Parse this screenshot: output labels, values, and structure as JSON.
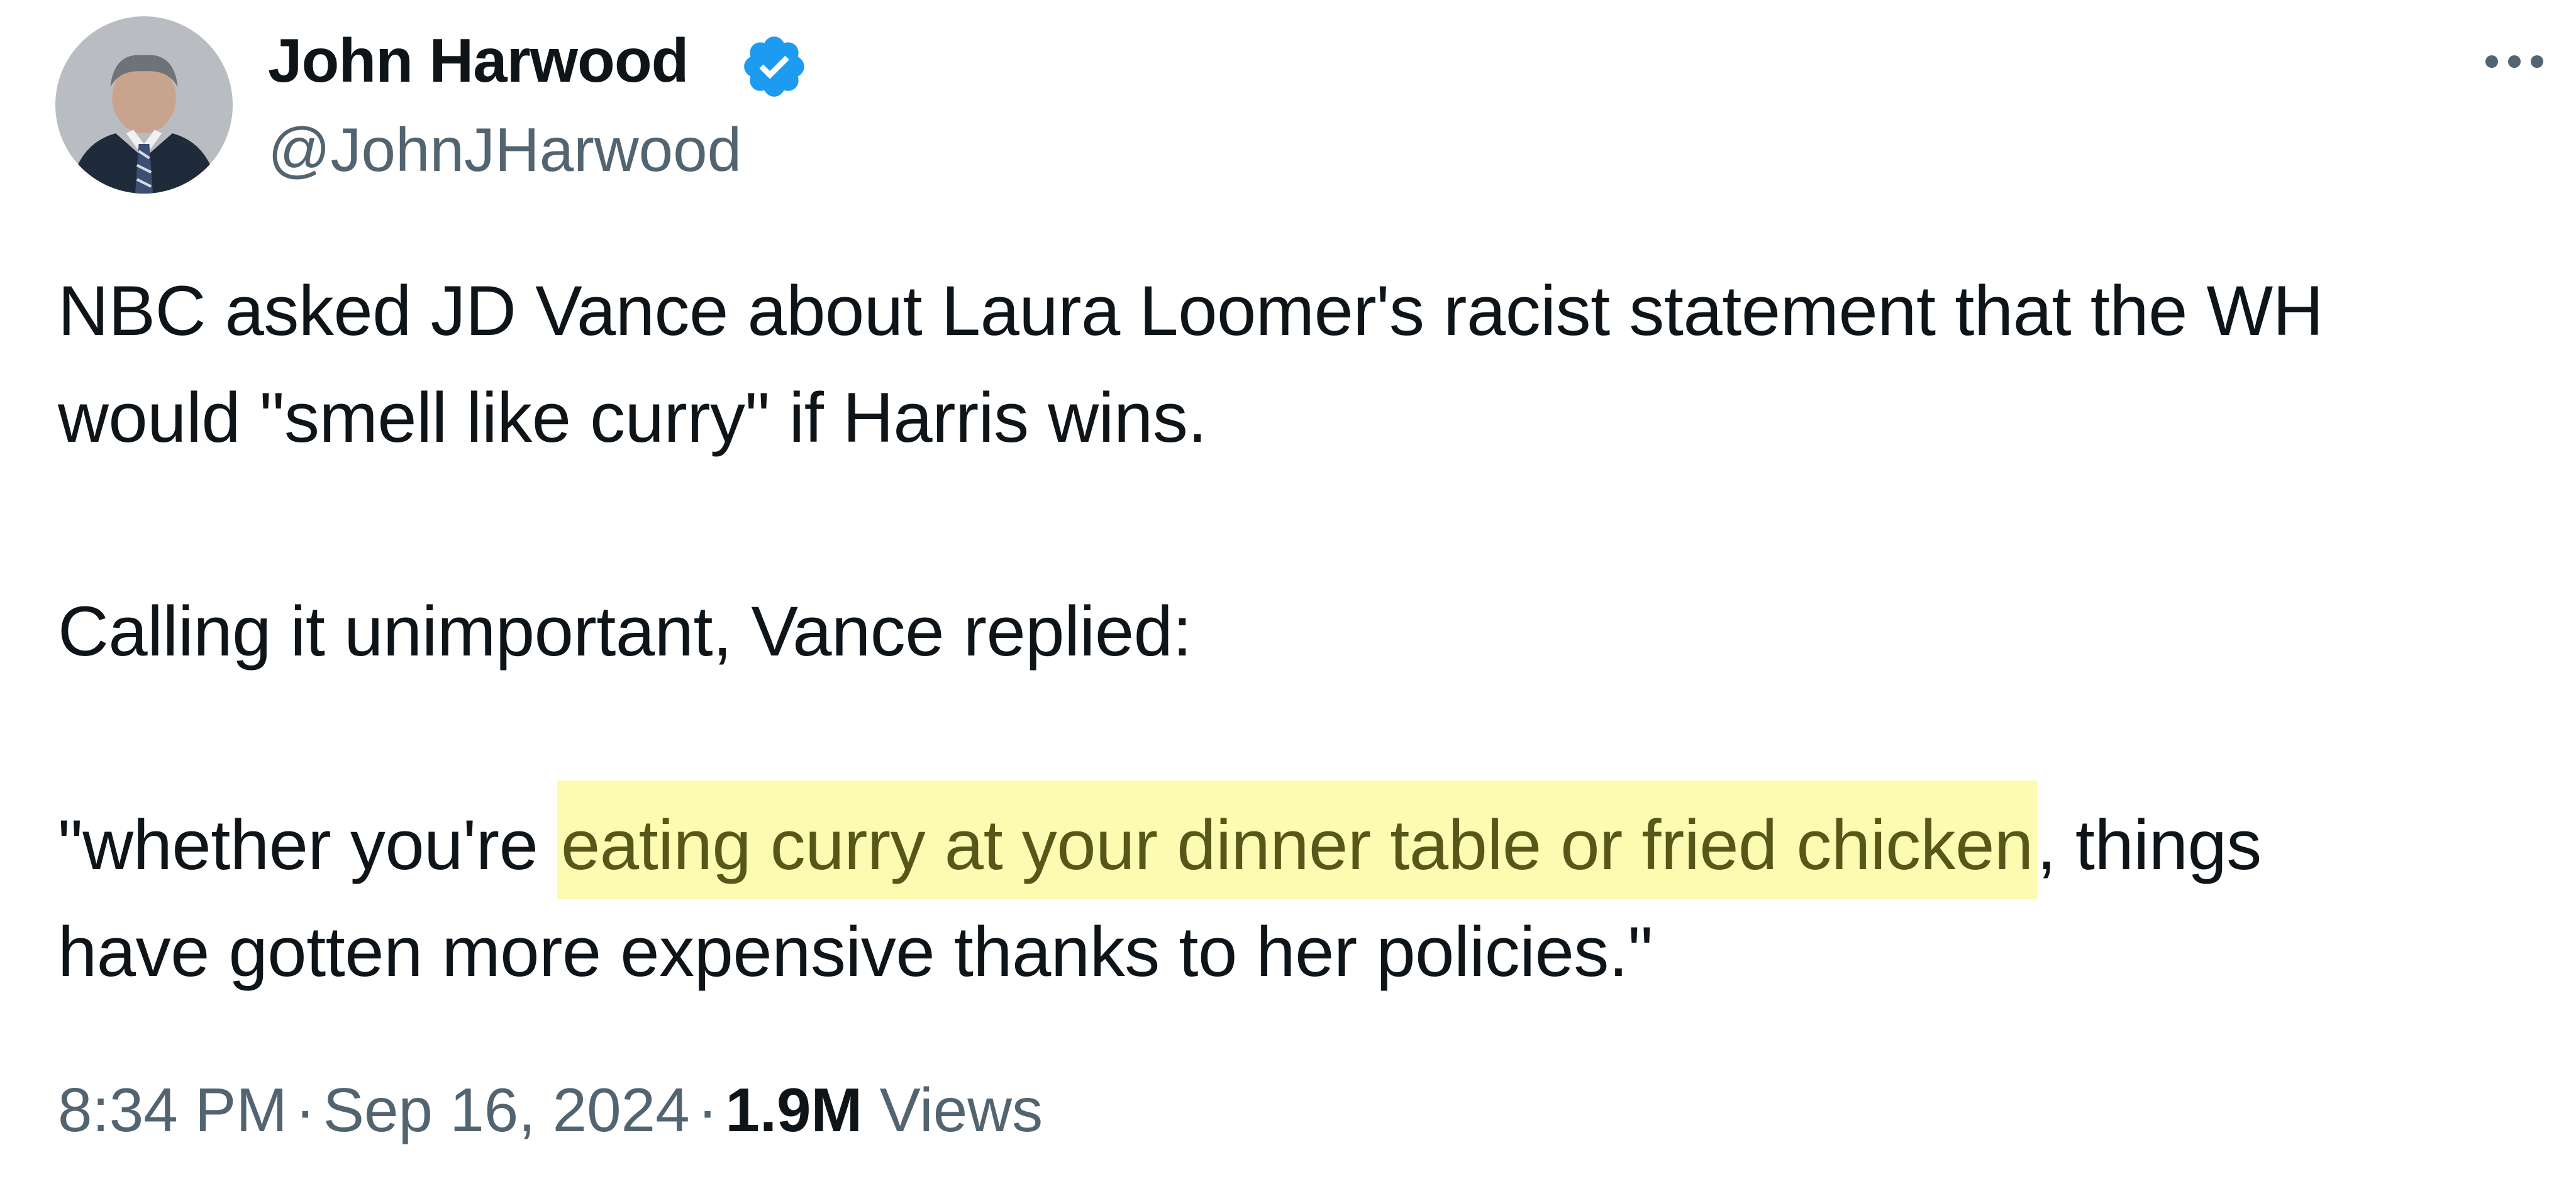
{
  "author": {
    "display_name": "John Harwood",
    "handle": "@JohnJHarwood",
    "verified": true,
    "avatar_icon": "avatar-photo"
  },
  "icons": {
    "verified": "verified-badge-icon",
    "more": "more-options-icon"
  },
  "tweet": {
    "line1": "NBC asked JD Vance about Laura Loomer's racist statement that the WH",
    "line2": "would \"smell like curry\" if Harris wins.",
    "line3": "Calling it unimportant, Vance replied:",
    "line4_before": "\"whether you're ",
    "line4_highlight": "eating curry at your dinner table or fried chicken",
    "line4_after": ", things",
    "line5": "have gotten more expensive thanks to her policies.\""
  },
  "meta": {
    "time": "8:34 PM",
    "separator": "·",
    "date": "Sep 16, 2024",
    "views_count": "1.9M",
    "views_label": "Views"
  },
  "colors": {
    "text": "#0f1419",
    "secondary": "#536471",
    "verified_blue": "#1d9bf0",
    "highlight_bg": "#fdfbb2",
    "highlight_text": "#57571a"
  }
}
